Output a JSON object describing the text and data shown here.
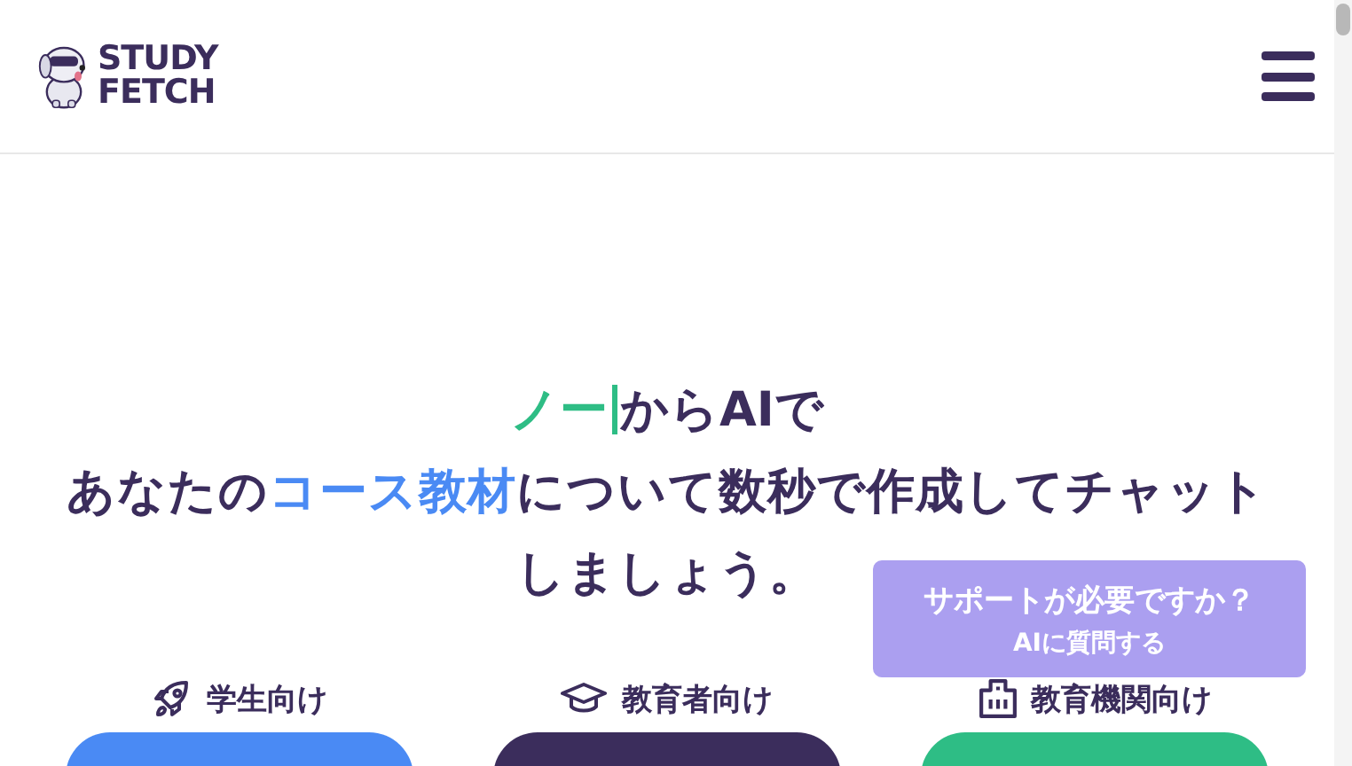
{
  "header": {
    "logo_lines": [
      "STUDY",
      "FETCH"
    ]
  },
  "hero": {
    "typed": "ノー",
    "rest": "からAIで",
    "body_parts": [
      {
        "text": "あなたの",
        "kind": "plain"
      },
      {
        "text": "コース教材",
        "kind": "accent"
      },
      {
        "text": "について数秒で作成してチャット",
        "kind": "plain"
      }
    ],
    "last_line": "しましょう。"
  },
  "audiences": [
    {
      "label": "学生向け",
      "kind": "rocket",
      "color": "#4a8af4"
    },
    {
      "label": "教育者向け",
      "kind": "cap",
      "color": "#3b2d5c"
    },
    {
      "label": "教育機関向け",
      "kind": "building",
      "color": "#2ebd85"
    }
  ],
  "support": {
    "title": "サポートが必要ですか？",
    "subtitle": "AIに質問する"
  }
}
